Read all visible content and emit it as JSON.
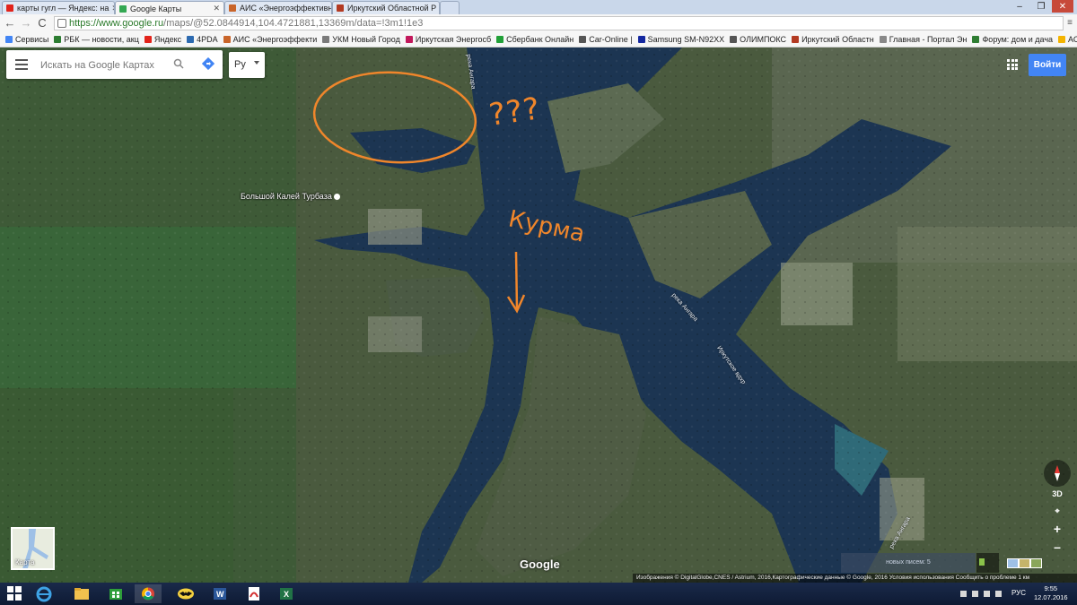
{
  "browser": {
    "tabs": [
      {
        "label": "карты гугл — Яндекс: на",
        "favicon_color": "#e2231a",
        "active": false
      },
      {
        "label": "Google Карты",
        "favicon_color": "#34a853",
        "active": true
      },
      {
        "label": "АИС «Энергоэффективн",
        "favicon_color": "#c9652a",
        "active": false
      },
      {
        "label": "Иркутский Областной Р",
        "favicon_color": "#b33a22",
        "active": false
      }
    ],
    "window_controls": {
      "minimize": "–",
      "restore": "❐",
      "close": "✕"
    },
    "nav": {
      "back": "←",
      "forward": "→",
      "reload": "C"
    },
    "url": {
      "prefix": "https://www.google.ru",
      "path": "/maps/@52.0844914,104.4721881,13369m/data=!3m1!1e3"
    },
    "bookmarks": [
      {
        "label": "Сервисы",
        "color": "#4285f4"
      },
      {
        "label": "РБК — новости, акц",
        "color": "#2d7d32"
      },
      {
        "label": "Яндекс",
        "color": "#e2231a"
      },
      {
        "label": "4PDA",
        "color": "#2c6ab0"
      },
      {
        "label": "АИС «Энергоэффекти",
        "color": "#c9652a"
      },
      {
        "label": "УКМ Новый Город",
        "color": "#7a7a7a"
      },
      {
        "label": "Иркутская Энергосб",
        "color": "#c2185b"
      },
      {
        "label": "Сбербанк Онлайн",
        "color": "#21a038"
      },
      {
        "label": "Car-Online |",
        "color": "#555555"
      },
      {
        "label": "Samsung SM-N92XX",
        "color": "#1428a0"
      },
      {
        "label": "ОЛИМПОКС",
        "color": "#555555"
      },
      {
        "label": "Иркутский Областн",
        "color": "#b33a22"
      },
      {
        "label": "Главная - Портал Эн",
        "color": "#888888"
      },
      {
        "label": "Форум: дом и дача",
        "color": "#2e7d32"
      },
      {
        "label": "АСУ \"Экология\"",
        "color": "#f4b400"
      }
    ]
  },
  "maps": {
    "search_placeholder": "Искать на Google Картах",
    "language": "Ру",
    "signin": "Войти",
    "place_label": "Большой Калей Турбаза",
    "river_labels": [
      "река Ангара",
      "река Ангара",
      "Иркутское вдхр",
      "река Ангара"
    ],
    "annotation_question": "???",
    "annotation_word": "Курма",
    "thumbnail_label": "Карта",
    "google_logo": "Google",
    "controls": {
      "tilt": "3D",
      "zoom_in": "+",
      "zoom_out": "–",
      "location": "⌖"
    },
    "attribution": "Изображения © DigitalGlobe,CNES / Astrium, 2016,Картографические данные © Google, 2016   Условия использования   Сообщить о проблеме   1 км",
    "mail_notice": "новых писем: 5"
  },
  "taskbar": {
    "lang": "РУС",
    "time": "9:55",
    "date": "12.07.2016",
    "apps": [
      "ie",
      "explorer",
      "store",
      "chrome",
      "batman",
      "word",
      "acrobat",
      "excel"
    ]
  },
  "colors": {
    "annotation": "#f0862b",
    "water": "#1c3552",
    "signin": "#4285f4"
  }
}
